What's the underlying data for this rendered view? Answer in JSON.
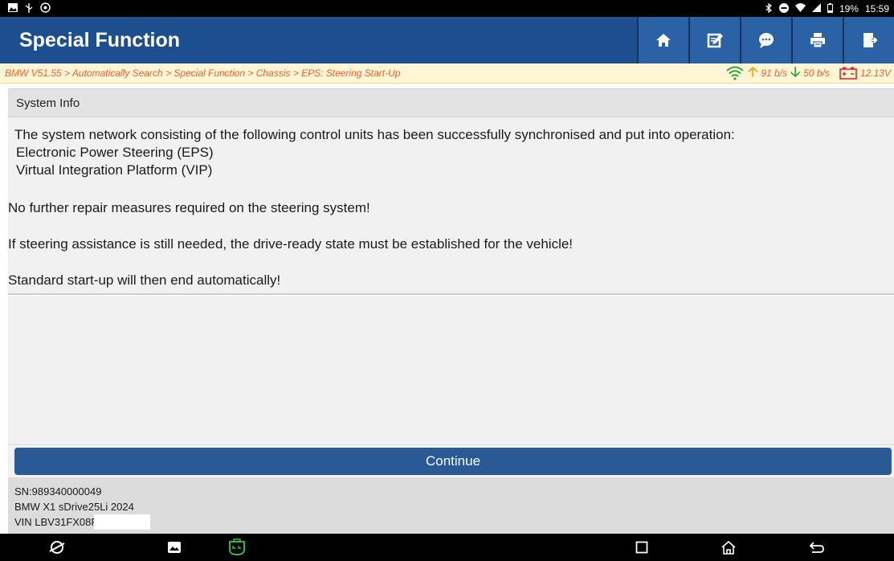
{
  "status_bar": {
    "battery": "19%",
    "time": "15:59"
  },
  "header": {
    "title": "Special Function",
    "buttons": [
      {
        "icon": "home-icon"
      },
      {
        "icon": "edit-icon"
      },
      {
        "icon": "message-icon"
      },
      {
        "icon": "print-icon"
      },
      {
        "icon": "exit-icon"
      }
    ]
  },
  "breadcrumb": {
    "text": "BMW V51.55 > Automatically Search > Special Function > Chassis > EPS: Steering Start-Up",
    "upload": "91 b/s",
    "download": "50 b/s",
    "voltage": "12.13V"
  },
  "section": {
    "title": "System Info"
  },
  "content": {
    "line1": "The system network consisting of the following control units has been successfully synchronised and put into operation:",
    "line2": "Electronic Power Steering (EPS)",
    "line3": "Virtual Integration Platform (VIP)",
    "line4": "No further repair measures required on the steering system!",
    "line5": "If steering assistance is still needed, the drive-ready state must be established for the vehicle!",
    "line6": "Standard start-up will then end automatically!"
  },
  "continue_label": "Continue",
  "device_info": {
    "sn": "SN:989340000049",
    "vehicle": "BMW X1 sDrive25Li 2024",
    "vin": "VIN LBV31FX08F"
  },
  "colors": {
    "header_bg": "#1d4f8e",
    "crumb_text": "#f2612c",
    "button_bg": "#2a5a95"
  }
}
